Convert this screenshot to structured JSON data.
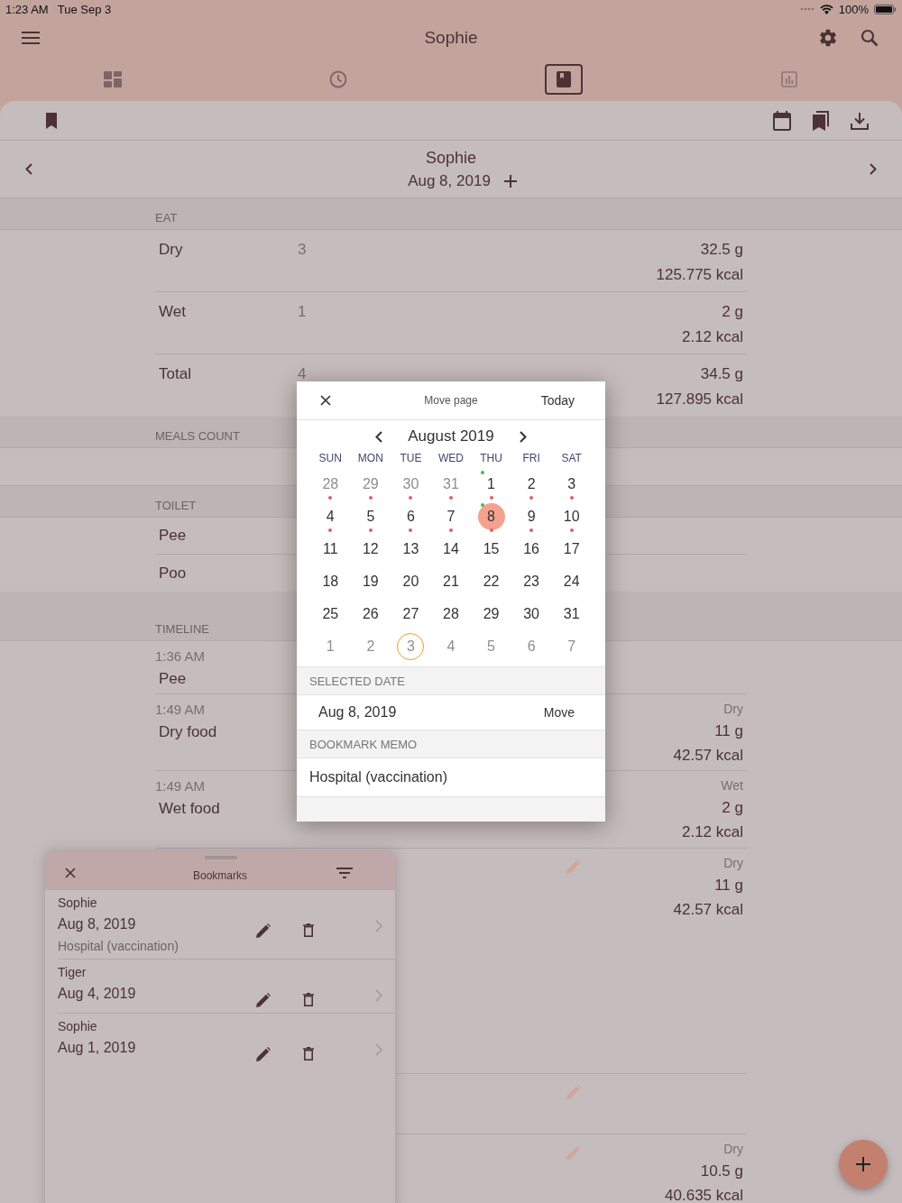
{
  "status_bar": {
    "time": "1:23 AM",
    "date": "Tue Sep 3",
    "battery": "100%"
  },
  "nav": {
    "title": "Sophie"
  },
  "tabs": [
    {
      "selected": false
    },
    {
      "selected": false
    },
    {
      "selected": true
    },
    {
      "selected": false
    }
  ],
  "page_header": {
    "name": "Sophie",
    "date": "Aug 8, 2019"
  },
  "eat": {
    "title": "EAT",
    "rows": [
      {
        "name": "Dry",
        "count": "3",
        "amount": "32.5 g",
        "energy": "125.775 kcal"
      },
      {
        "name": "Wet",
        "count": "1",
        "amount": "2 g",
        "energy": "2.12 kcal"
      },
      {
        "name": "Total",
        "count": "4",
        "amount": "34.5 g",
        "energy": "127.895 kcal"
      }
    ]
  },
  "meals_count": {
    "title": "MEALS COUNT"
  },
  "toilet": {
    "title": "TOILET",
    "rows": [
      {
        "name": "Pee"
      },
      {
        "name": "Poo"
      }
    ]
  },
  "timeline": {
    "title": "TIMELINE",
    "entries": [
      {
        "time": "1:36 AM",
        "label": "Pee",
        "edit_icon": false
      },
      {
        "time": "1:49 AM",
        "label": "Dry food",
        "food": "Dry",
        "amount": "11 g",
        "energy": "42.57 kcal",
        "edit_icon": false
      },
      {
        "time": "1:49 AM",
        "label": "Wet food",
        "food": "Wet",
        "amount": "2 g",
        "energy": "2.12 kcal",
        "edit_icon": false
      },
      {
        "food": "Dry",
        "amount": "11 g",
        "energy": "42.57 kcal",
        "edit_icon": true
      },
      {
        "edit_icon": true
      },
      {
        "food": "Dry",
        "amount": "10.5 g",
        "energy": "40.635 kcal",
        "edit_icon": true
      }
    ]
  },
  "move_dialog": {
    "title": "Move page",
    "today_button": "Today",
    "month": "August 2019",
    "weekdays": [
      "SUN",
      "MON",
      "TUE",
      "WED",
      "THU",
      "FRI",
      "SAT"
    ],
    "weeks": [
      [
        {
          "day": "28",
          "outside": true,
          "dot": true,
          "flag": false,
          "selected": false,
          "today": false
        },
        {
          "day": "29",
          "outside": true,
          "dot": true,
          "flag": false,
          "selected": false,
          "today": false
        },
        {
          "day": "30",
          "outside": true,
          "dot": true,
          "flag": false,
          "selected": false,
          "today": false
        },
        {
          "day": "31",
          "outside": true,
          "dot": true,
          "flag": false,
          "selected": false,
          "today": false
        },
        {
          "day": "1",
          "outside": false,
          "dot": true,
          "flag": true,
          "selected": false,
          "today": false
        },
        {
          "day": "2",
          "outside": false,
          "dot": true,
          "flag": false,
          "selected": false,
          "today": false
        },
        {
          "day": "3",
          "outside": false,
          "dot": true,
          "flag": false,
          "selected": false,
          "today": false
        }
      ],
      [
        {
          "day": "4",
          "outside": false,
          "dot": true,
          "flag": false,
          "selected": false,
          "today": false
        },
        {
          "day": "5",
          "outside": false,
          "dot": true,
          "flag": false,
          "selected": false,
          "today": false
        },
        {
          "day": "6",
          "outside": false,
          "dot": true,
          "flag": false,
          "selected": false,
          "today": false
        },
        {
          "day": "7",
          "outside": false,
          "dot": true,
          "flag": false,
          "selected": false,
          "today": false
        },
        {
          "day": "8",
          "outside": false,
          "dot": true,
          "flag": true,
          "selected": true,
          "today": false
        },
        {
          "day": "9",
          "outside": false,
          "dot": true,
          "flag": false,
          "selected": false,
          "today": false
        },
        {
          "day": "10",
          "outside": false,
          "dot": true,
          "flag": false,
          "selected": false,
          "today": false
        }
      ],
      [
        {
          "day": "11",
          "outside": false,
          "dot": false,
          "flag": false,
          "selected": false,
          "today": false
        },
        {
          "day": "12",
          "outside": false,
          "dot": false,
          "flag": false,
          "selected": false,
          "today": false
        },
        {
          "day": "13",
          "outside": false,
          "dot": false,
          "flag": false,
          "selected": false,
          "today": false
        },
        {
          "day": "14",
          "outside": false,
          "dot": false,
          "flag": false,
          "selected": false,
          "today": false
        },
        {
          "day": "15",
          "outside": false,
          "dot": false,
          "flag": false,
          "selected": false,
          "today": false
        },
        {
          "day": "16",
          "outside": false,
          "dot": false,
          "flag": false,
          "selected": false,
          "today": false
        },
        {
          "day": "17",
          "outside": false,
          "dot": false,
          "flag": false,
          "selected": false,
          "today": false
        }
      ],
      [
        {
          "day": "18",
          "outside": false,
          "dot": false,
          "flag": false,
          "selected": false,
          "today": false
        },
        {
          "day": "19",
          "outside": false,
          "dot": false,
          "flag": false,
          "selected": false,
          "today": false
        },
        {
          "day": "20",
          "outside": false,
          "dot": false,
          "flag": false,
          "selected": false,
          "today": false
        },
        {
          "day": "21",
          "outside": false,
          "dot": false,
          "flag": false,
          "selected": false,
          "today": false
        },
        {
          "day": "22",
          "outside": false,
          "dot": false,
          "flag": false,
          "selected": false,
          "today": false
        },
        {
          "day": "23",
          "outside": false,
          "dot": false,
          "flag": false,
          "selected": false,
          "today": false
        },
        {
          "day": "24",
          "outside": false,
          "dot": false,
          "flag": false,
          "selected": false,
          "today": false
        }
      ],
      [
        {
          "day": "25",
          "outside": false,
          "dot": false,
          "flag": false,
          "selected": false,
          "today": false
        },
        {
          "day": "26",
          "outside": false,
          "dot": false,
          "flag": false,
          "selected": false,
          "today": false
        },
        {
          "day": "27",
          "outside": false,
          "dot": false,
          "flag": false,
          "selected": false,
          "today": false
        },
        {
          "day": "28",
          "outside": false,
          "dot": false,
          "flag": false,
          "selected": false,
          "today": false
        },
        {
          "day": "29",
          "outside": false,
          "dot": false,
          "flag": false,
          "selected": false,
          "today": false
        },
        {
          "day": "30",
          "outside": false,
          "dot": false,
          "flag": false,
          "selected": false,
          "today": false
        },
        {
          "day": "31",
          "outside": false,
          "dot": false,
          "flag": false,
          "selected": false,
          "today": false
        }
      ],
      [
        {
          "day": "1",
          "outside": true,
          "dot": false,
          "flag": false,
          "selected": false,
          "today": false
        },
        {
          "day": "2",
          "outside": true,
          "dot": false,
          "flag": false,
          "selected": false,
          "today": false
        },
        {
          "day": "3",
          "outside": true,
          "dot": false,
          "flag": false,
          "selected": false,
          "today": true
        },
        {
          "day": "4",
          "outside": true,
          "dot": false,
          "flag": false,
          "selected": false,
          "today": false
        },
        {
          "day": "5",
          "outside": true,
          "dot": false,
          "flag": false,
          "selected": false,
          "today": false
        },
        {
          "day": "6",
          "outside": true,
          "dot": false,
          "flag": false,
          "selected": false,
          "today": false
        },
        {
          "day": "7",
          "outside": true,
          "dot": false,
          "flag": false,
          "selected": false,
          "today": false
        }
      ]
    ],
    "selected_date_header": "SELECTED DATE",
    "selected_date": "Aug 8, 2019",
    "move_button": "Move",
    "memo_header": "BOOKMARK MEMO",
    "memo": "Hospital (vaccination)"
  },
  "bookmarks": {
    "title": "Bookmarks",
    "items": [
      {
        "name": "Sophie",
        "date": "Aug 8, 2019",
        "memo": "Hospital (vaccination)"
      },
      {
        "name": "Tiger",
        "date": "Aug 4, 2019"
      },
      {
        "name": "Sophie",
        "date": "Aug 1, 2019"
      }
    ]
  }
}
